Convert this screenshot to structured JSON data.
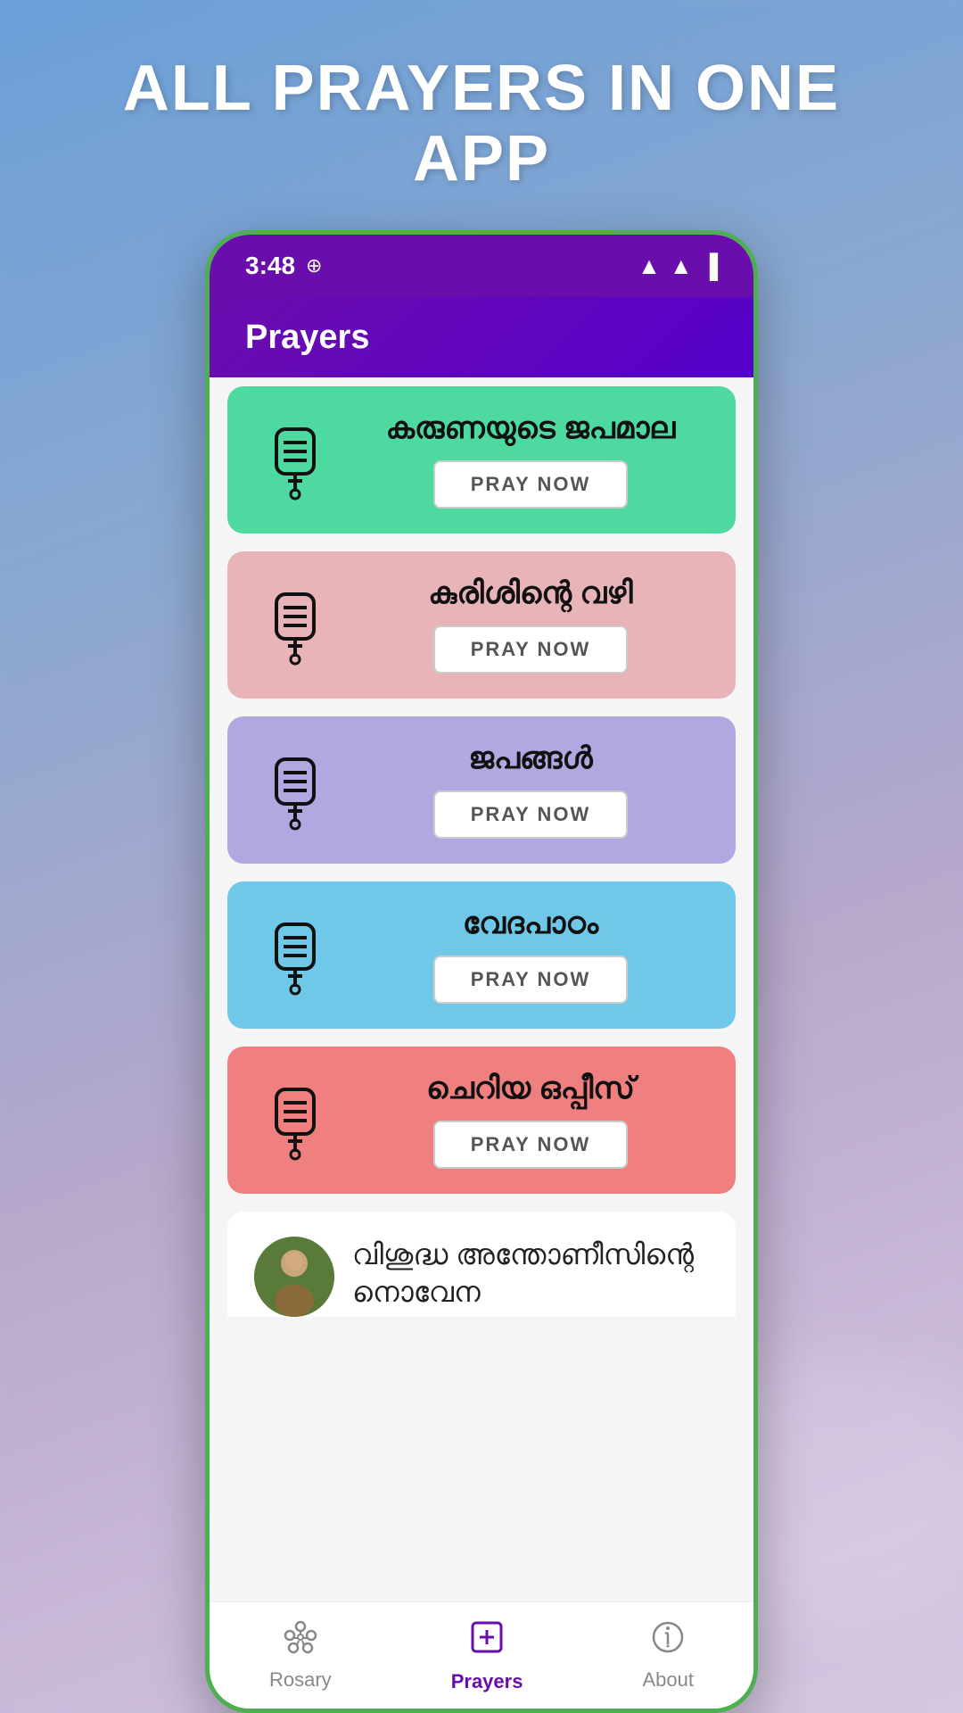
{
  "headline": "ALL PRAYERS IN ONE APP",
  "status": {
    "time": "3:48",
    "sim_icon": "⊕"
  },
  "app_header": {
    "title": "Prayers"
  },
  "prayer_cards": [
    {
      "id": "card-1",
      "title": "കരുണയുടെ ജപമാല",
      "button_label": "PRAY NOW",
      "color_class": "card-green"
    },
    {
      "id": "card-2",
      "title": "കുരിശിന്റെ വഴി",
      "button_label": "PRAY NOW",
      "color_class": "card-pink"
    },
    {
      "id": "card-3",
      "title": "ജപങ്ങൾ",
      "button_label": "PRAY NOW",
      "color_class": "card-purple"
    },
    {
      "id": "card-4",
      "title": "വേദപാഠം",
      "button_label": "PRAY NOW",
      "color_class": "card-blue"
    },
    {
      "id": "card-5",
      "title": "ചെറിയ ഒപ്പീസ്",
      "button_label": "PRAY NOW",
      "color_class": "card-salmon"
    }
  ],
  "partial_card": {
    "title": "വിശുദ്ധ അന്തോണീസിന്റെ നൊവേന"
  },
  "bottom_nav": {
    "items": [
      {
        "id": "rosary",
        "label": "Rosary",
        "active": false
      },
      {
        "id": "prayers",
        "label": "Prayers",
        "active": true
      },
      {
        "id": "about",
        "label": "About",
        "active": false
      }
    ]
  }
}
